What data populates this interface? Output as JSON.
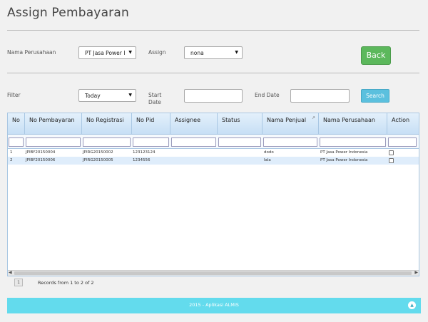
{
  "page": {
    "title": "Assign Pembayaran"
  },
  "form": {
    "company_label": "Nama Perusahaan",
    "company_value": "PT Jasa Power I",
    "assign_label": "Assign",
    "assign_value": "nona",
    "back_label": "Back",
    "filter_label": "Filter",
    "filter_value": "Today",
    "start_date_label": "Start Date",
    "start_date_value": "",
    "end_date_label": "End Date",
    "end_date_value": "",
    "search_label": "Search",
    "dropdown_icon": "caret-down-icon"
  },
  "grid": {
    "columns": [
      "No",
      "No Pembayaran",
      "No Registrasi",
      "No Pid",
      "Assignee",
      "Status",
      "Nama Penjual",
      "Nama Perusahaan",
      "Action"
    ],
    "sort_icon": "sort-icon",
    "rows": [
      {
        "no": "1",
        "no_pembayaran": "JPIBY20150004",
        "no_registrasi": "JPIRG20150002",
        "no_pid": "123123124",
        "assignee": "",
        "status": "",
        "nama_penjual": "dodo",
        "nama_perusahaan": "PT Jasa Power Indonesia",
        "action_checked": false
      },
      {
        "no": "2",
        "no_pembayaran": "JPIBY20150006",
        "no_registrasi": "JPIRG20150005",
        "no_pid": "1234556",
        "assignee": "",
        "status": "",
        "nama_penjual": "lala",
        "nama_perusahaan": "PT Jasa Power Indonesia",
        "action_checked": false
      }
    ],
    "page_number": "1",
    "records_text": "Records from 1 to 2 of 2"
  },
  "footer": {
    "text": "2015 - Aplikasi ALMIS",
    "up_icon": "chevron-up-icon"
  }
}
